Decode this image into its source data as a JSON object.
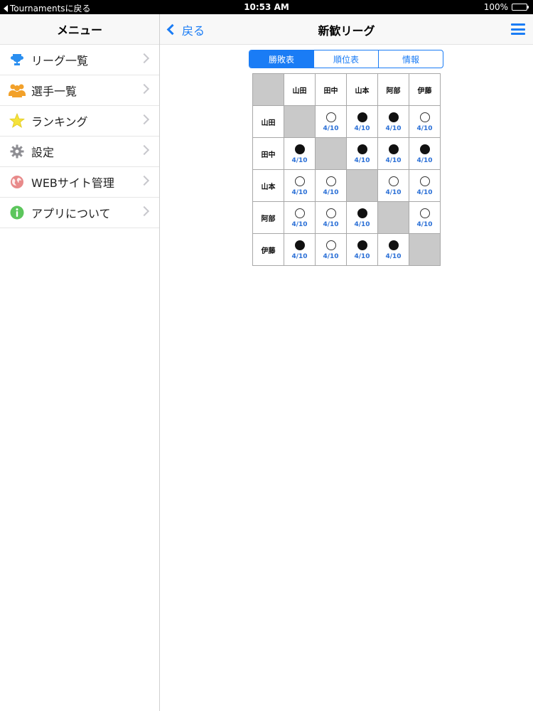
{
  "status_bar": {
    "back_app": "Tournamentsに戻る",
    "time": "10:53 AM",
    "battery": "100%"
  },
  "sidebar": {
    "title": "メニュー",
    "items": [
      {
        "label": "リーグ一覧",
        "icon": "trophy-icon"
      },
      {
        "label": "選手一覧",
        "icon": "people-icon"
      },
      {
        "label": "ランキング",
        "icon": "star-icon"
      },
      {
        "label": "設定",
        "icon": "gear-icon"
      },
      {
        "label": "WEBサイト管理",
        "icon": "globe-icon"
      },
      {
        "label": "アプリについて",
        "icon": "info-icon"
      }
    ]
  },
  "navbar": {
    "back_label": "戻る",
    "title": "新歓リーグ"
  },
  "tabs": [
    {
      "label": "勝敗表",
      "active": true
    },
    {
      "label": "順位表",
      "active": false
    },
    {
      "label": "情報",
      "active": false
    }
  ],
  "match_grid": {
    "players": [
      "山田",
      "田中",
      "山本",
      "阿部",
      "伊藤"
    ],
    "rows": [
      [
        null,
        {
          "result": "loss",
          "date": "4/10"
        },
        {
          "result": "win",
          "date": "4/10"
        },
        {
          "result": "win",
          "date": "4/10"
        },
        {
          "result": "loss",
          "date": "4/10"
        }
      ],
      [
        {
          "result": "win",
          "date": "4/10"
        },
        null,
        {
          "result": "win",
          "date": "4/10"
        },
        {
          "result": "win",
          "date": "4/10"
        },
        {
          "result": "win",
          "date": "4/10"
        }
      ],
      [
        {
          "result": "loss",
          "date": "4/10"
        },
        {
          "result": "loss",
          "date": "4/10"
        },
        null,
        {
          "result": "loss",
          "date": "4/10"
        },
        {
          "result": "loss",
          "date": "4/10"
        }
      ],
      [
        {
          "result": "loss",
          "date": "4/10"
        },
        {
          "result": "loss",
          "date": "4/10"
        },
        {
          "result": "win",
          "date": "4/10"
        },
        null,
        {
          "result": "loss",
          "date": "4/10"
        }
      ],
      [
        {
          "result": "win",
          "date": "4/10"
        },
        {
          "result": "loss",
          "date": "4/10"
        },
        {
          "result": "win",
          "date": "4/10"
        },
        {
          "result": "win",
          "date": "4/10"
        },
        null
      ]
    ]
  },
  "colors": {
    "accent": "#1a7cf5",
    "date_text": "#2a6fd6",
    "diagonal": "#c9c9c9"
  }
}
